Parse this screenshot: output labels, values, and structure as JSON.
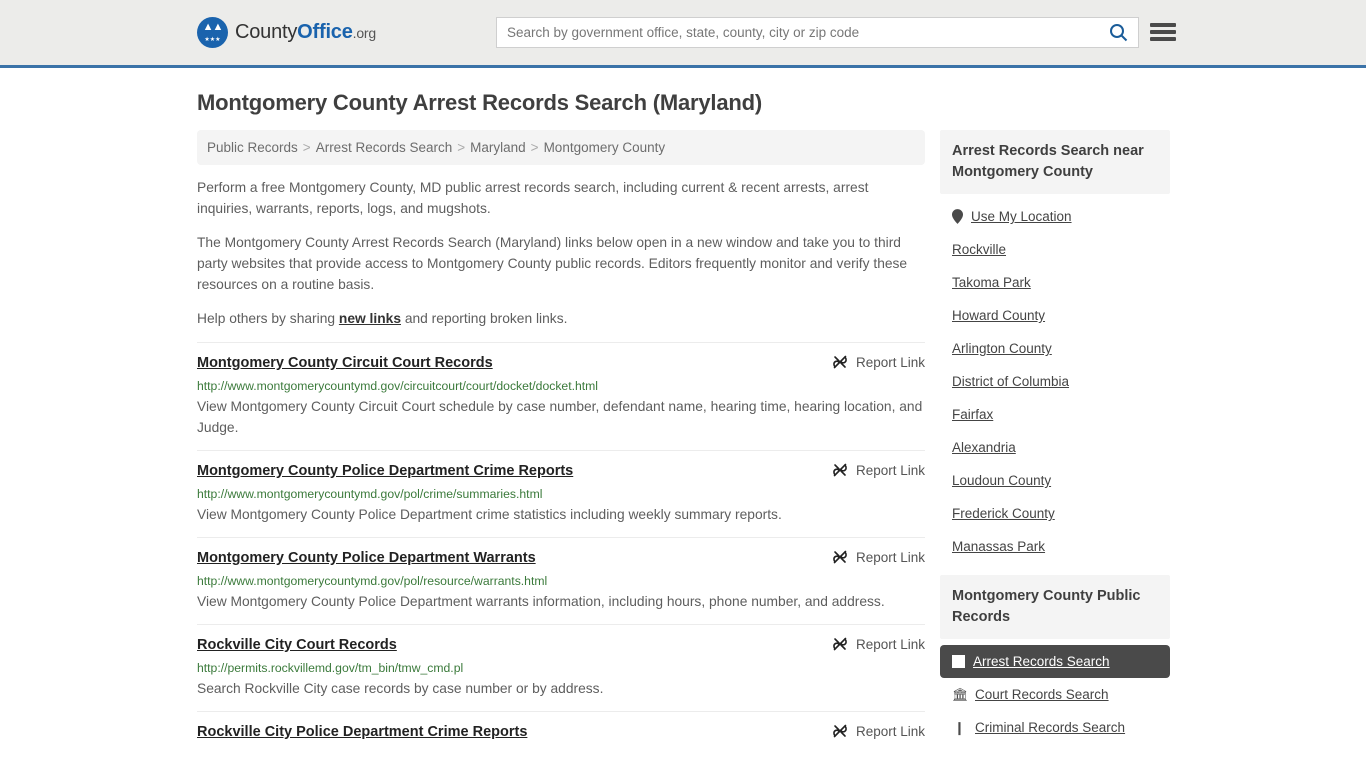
{
  "header": {
    "logo": {
      "county_text": "County",
      "office_text": "Office",
      "tld_text": ".org",
      "eagle_icon": "eagle-icon",
      "stars_icon": "three-stars-icon"
    },
    "search": {
      "placeholder": "Search by government office, state, county, city or zip code",
      "value": "",
      "search_icon": "search-icon"
    },
    "menu_icon": "hamburger-menu-icon",
    "accent_color": "#1a63ad",
    "border_color": "#3b73a8",
    "background_color": "#ececea"
  },
  "page": {
    "title": "Montgomery County Arrest Records Search (Maryland)"
  },
  "breadcrumb": {
    "separator": ">",
    "items": [
      {
        "label": "Public Records"
      },
      {
        "label": "Arrest Records Search"
      },
      {
        "label": "Maryland"
      },
      {
        "label": "Montgomery County"
      }
    ]
  },
  "intro": {
    "paragraph1": "Perform a free Montgomery County, MD public arrest records search, including current & recent arrests, arrest inquiries, warrants, reports, logs, and mugshots.",
    "paragraph2": "The Montgomery County Arrest Records Search (Maryland) links below open in a new window and take you to third party websites that provide access to Montgomery County public records. Editors frequently monitor and verify these resources on a routine basis.",
    "help_prefix": "Help others by sharing ",
    "help_link": "new links",
    "help_suffix": " and reporting broken links."
  },
  "results": {
    "report_link_label": "Report Link",
    "report_link_icon": "broken-link-icon",
    "items": [
      {
        "title": "Montgomery County Circuit Court Records",
        "url": "http://www.montgomerycountymd.gov/circuitcourt/court/docket/docket.html",
        "description": "View Montgomery County Circuit Court schedule by case number, defendant name, hearing time, hearing location, and Judge."
      },
      {
        "title": "Montgomery County Police Department Crime Reports",
        "url": "http://www.montgomerycountymd.gov/pol/crime/summaries.html",
        "description": "View Montgomery County Police Department crime statistics including weekly summary reports."
      },
      {
        "title": "Montgomery County Police Department Warrants",
        "url": "http://www.montgomerycountymd.gov/pol/resource/warrants.html",
        "description": "View Montgomery County Police Department warrants information, including hours, phone number, and address."
      },
      {
        "title": "Rockville City Court Records",
        "url": "http://permits.rockvillemd.gov/tm_bin/tmw_cmd.pl",
        "description": "Search Rockville City case records by case number or by address."
      },
      {
        "title": "Rockville City Police Department Crime Reports",
        "url": "",
        "description": ""
      }
    ]
  },
  "sidebar": {
    "nearby": {
      "heading": "Arrest Records Search near Montgomery County",
      "items": [
        {
          "label": "Use My Location",
          "icon": "map-pin-icon"
        },
        {
          "label": "Rockville",
          "icon": ""
        },
        {
          "label": "Takoma Park",
          "icon": ""
        },
        {
          "label": "Howard County",
          "icon": ""
        },
        {
          "label": "Arlington County",
          "icon": ""
        },
        {
          "label": "District of Columbia",
          "icon": ""
        },
        {
          "label": "Fairfax",
          "icon": ""
        },
        {
          "label": "Alexandria",
          "icon": ""
        },
        {
          "label": "Loudoun County",
          "icon": ""
        },
        {
          "label": "Frederick County",
          "icon": ""
        },
        {
          "label": "Manassas Park",
          "icon": ""
        }
      ]
    },
    "public_records": {
      "heading": "Montgomery County Public Records",
      "items": [
        {
          "label": "Arrest Records Search",
          "icon": "white-square-icon",
          "active": true
        },
        {
          "label": "Court Records Search",
          "icon": "bank-icon",
          "active": false
        },
        {
          "label": "Criminal Records Search",
          "icon": "document-icon",
          "active": false
        }
      ]
    },
    "active_background_color": "#4a4a4a"
  }
}
